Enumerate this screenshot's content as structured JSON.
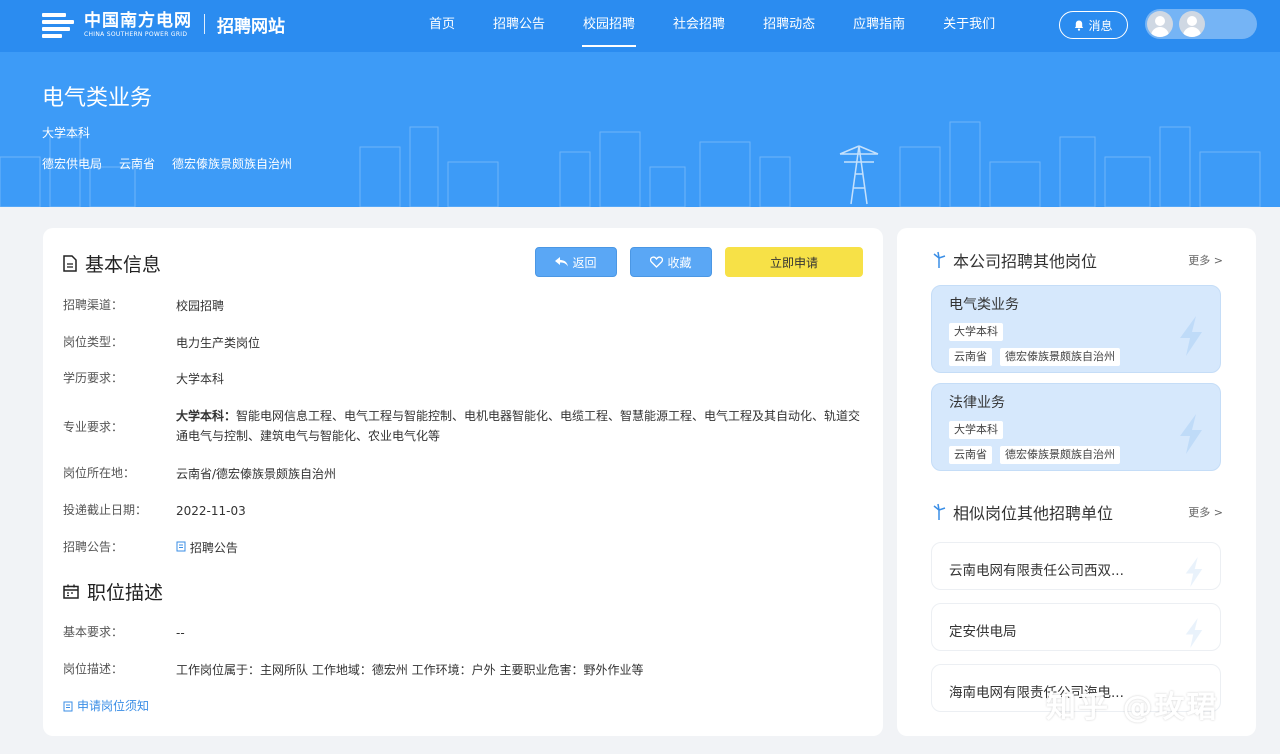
{
  "brand": {
    "cn": "中国南方电网",
    "en": "CHINA SOUTHERN POWER GRID",
    "site": "招聘网站"
  },
  "nav": {
    "items": [
      {
        "label": "首页"
      },
      {
        "label": "招聘公告"
      },
      {
        "label": "校园招聘",
        "active": true
      },
      {
        "label": "社会招聘"
      },
      {
        "label": "招聘动态"
      },
      {
        "label": "应聘指南"
      },
      {
        "label": "关于我们"
      }
    ],
    "message": "消息"
  },
  "banner": {
    "title": "电气类业务",
    "education": "大学本科",
    "locations": [
      "德宏供电局",
      "云南省",
      "德宏傣族景颇族自治州"
    ]
  },
  "basic_info": {
    "heading": "基本信息",
    "buttons": {
      "back": "返回",
      "favorite": "收藏",
      "apply": "立即申请"
    },
    "rows": [
      {
        "key": "招聘渠道：",
        "value": "校园招聘"
      },
      {
        "key": "岗位类型：",
        "value": "电力生产类岗位"
      },
      {
        "key": "学历要求：",
        "value": "大学本科"
      },
      {
        "key": "专业要求：",
        "bold": "大学本科：",
        "value": "智能电网信息工程、电气工程与智能控制、电机电器智能化、电缆工程、智慧能源工程、电气工程及其自动化、轨道交通电气与控制、建筑电气与智能化、农业电气化等"
      },
      {
        "key": "岗位所在地：",
        "value": "云南省/德宏傣族景颇族自治州"
      },
      {
        "key": "投递截止日期：",
        "value": "2022-11-03"
      },
      {
        "key": "招聘公告：",
        "value": "招聘公告"
      }
    ]
  },
  "job_desc": {
    "heading": "职位描述",
    "rows": [
      {
        "key": "基本要求：",
        "value": "--"
      },
      {
        "key": "岗位描述：",
        "value": "工作岗位属于：主网所队 工作地域：德宏州 工作环境：户外 主要职业危害：野外作业等"
      }
    ],
    "notice_link": "申请岗位须知"
  },
  "other_positions": {
    "heading": "本公司招聘其他岗位",
    "more": "更多 >",
    "cards": [
      {
        "title": "电气类业务",
        "edu": "大学本科",
        "province": "云南省",
        "region": "德宏傣族景颇族自治州"
      },
      {
        "title": "法律业务",
        "edu": "大学本科",
        "province": "云南省",
        "region": "德宏傣族景颇族自治州"
      }
    ]
  },
  "similar_units": {
    "heading": "相似岗位其他招聘单位",
    "more": "更多 >",
    "items": [
      {
        "name": "云南电网有限责任公司西双..."
      },
      {
        "name": "定安供电局"
      },
      {
        "name": "海南电网有限责任公司海电..."
      }
    ]
  },
  "watermark": "知乎 @玫珺",
  "colors": {
    "nav": "#2b8cf0",
    "banner": "#3d9bf7",
    "apply": "#f7e147",
    "card": "#d6e8fc"
  }
}
